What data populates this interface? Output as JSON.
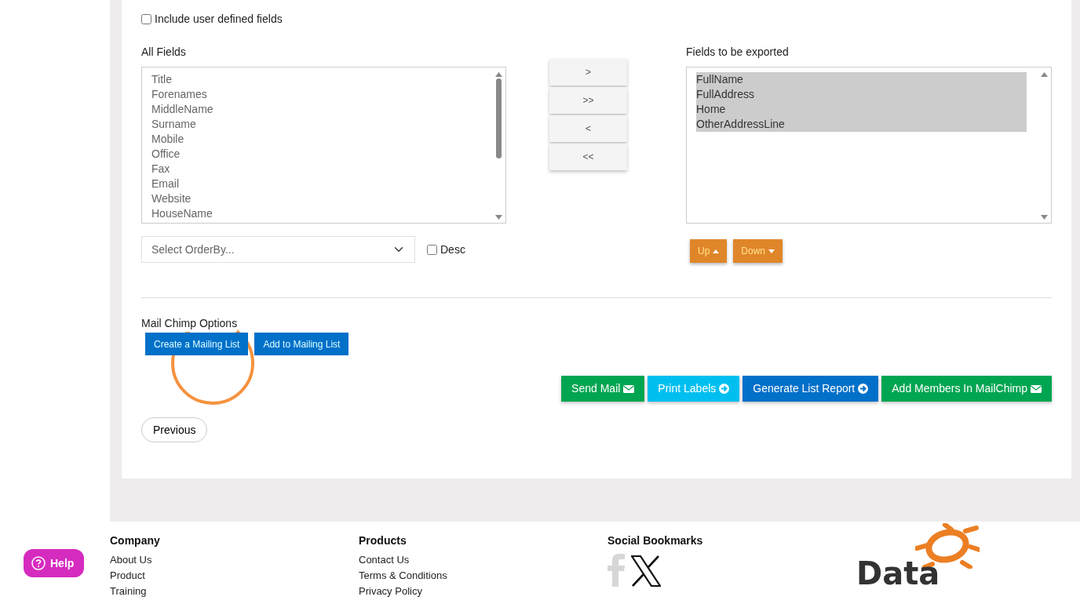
{
  "include_user_fields": {
    "label": "Include user defined fields",
    "checked": false
  },
  "all_fields": {
    "label": "All Fields",
    "items": [
      "Title",
      "Forenames",
      "MiddleName",
      "Surname",
      "Mobile",
      "Office",
      "Fax",
      "Email",
      "Website",
      "HouseName"
    ]
  },
  "transfer_buttons": [
    ">",
    ">>",
    "<",
    "<<"
  ],
  "order_by": {
    "placeholder": "Select OrderBy..."
  },
  "desc": {
    "label": "Desc",
    "checked": false
  },
  "export_fields": {
    "label": "Fields to be exported",
    "items": [
      {
        "text": "FullName",
        "selected": true
      },
      {
        "text": "FullAddress",
        "selected": true
      },
      {
        "text": "Home",
        "selected": true
      },
      {
        "text": "OtherAddressLine",
        "selected": true
      }
    ]
  },
  "order_buttons": [
    {
      "label": "Up",
      "kind": "up"
    },
    {
      "label": "Down",
      "kind": "down"
    }
  ],
  "mailchimp": {
    "title": "Mail Chimp Options",
    "buttons": [
      "Create a Mailing List",
      "Add to Mailing List"
    ]
  },
  "action_buttons": [
    {
      "label": "Send Mail",
      "kind": "success"
    },
    {
      "label": "Print Labels",
      "kind": "info"
    },
    {
      "label": "Generate List Report",
      "kind": "primary"
    },
    {
      "label": "Add Members In MailChimp",
      "kind": "success"
    }
  ],
  "previous_button": "Previous",
  "footer": {
    "columns": [
      {
        "heading": "Company",
        "links": [
          "About Us",
          "Product",
          "Training"
        ]
      },
      {
        "heading": "Products",
        "links": [
          "Contact Us",
          "Terms & Conditions",
          "Privacy Policy"
        ]
      }
    ],
    "social": {
      "heading": "Social Bookmarks"
    },
    "logo": {
      "text": "Data"
    }
  },
  "help_button": {
    "label": "Help"
  }
}
